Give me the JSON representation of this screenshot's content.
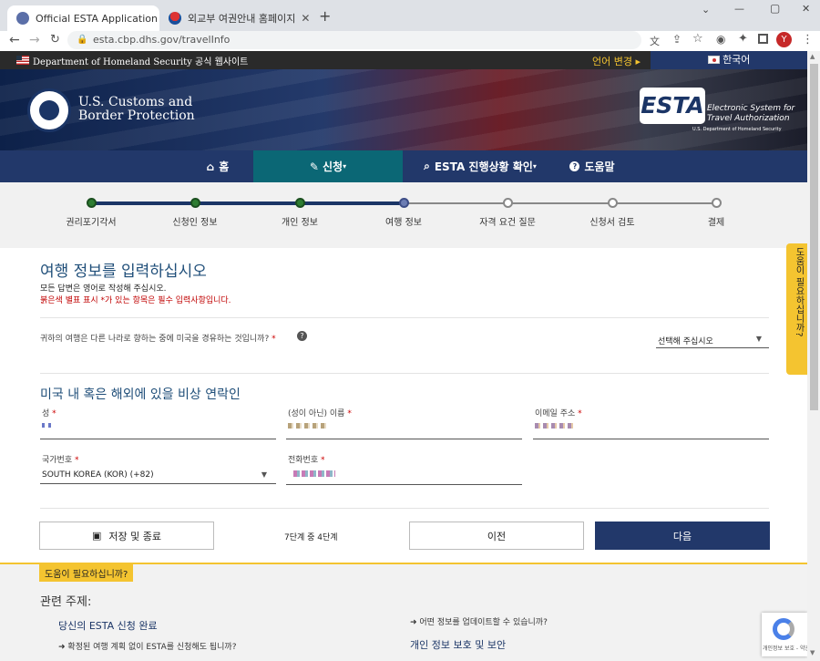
{
  "browser": {
    "tabs": [
      {
        "title": "Official ESTA Application Websi",
        "active": true
      },
      {
        "title": "외교부 여권안내 홈페이지",
        "active": false
      }
    ],
    "new_tab": "+",
    "url": "esta.cbp.dhs.gov/travelInfo",
    "avatar": "Y",
    "window_controls": [
      "⌄",
      "—",
      "▢",
      "✕"
    ]
  },
  "site": {
    "top_strip": {
      "agency": "Department of Homeland Security 공식 웹사이트",
      "change_language": "언어 변경",
      "language": "한국어"
    },
    "banner": {
      "org_line1": "U.S. Customs and",
      "org_line2": "Border Protection",
      "esta_logo": "ESTA",
      "esta_line1": "Electronic System for",
      "esta_line2": "Travel Authorization",
      "esta_line3": "U.S. Department of Homeland Security"
    },
    "nav": {
      "home": "홈",
      "apply": "신청",
      "status": "ESTA 진행상황 확인",
      "help": "도움말"
    },
    "steps": [
      {
        "label": "권리포기각서",
        "state": "done"
      },
      {
        "label": "신청인 정보",
        "state": "done"
      },
      {
        "label": "개인 정보",
        "state": "done"
      },
      {
        "label": "여행 정보",
        "state": "current"
      },
      {
        "label": "자격 요건 질문",
        "state": "todo"
      },
      {
        "label": "신청서 검토",
        "state": "todo"
      },
      {
        "label": "결제",
        "state": "todo"
      }
    ],
    "side_help": "도움이 필요하십니까?",
    "form": {
      "title": "여행 정보를 입력하십시오",
      "note": "모든 답변은 영어로 작성해 주십시오.",
      "required_note": "붉은색 별표 표시 *가 있는 항목은 필수 입력사항입니다.",
      "transit_question": "귀하의 여행은 다른 나라로 향하는 중에 미국을 경유하는 것입니까?",
      "transit_select": "선택해 주십시오",
      "section_title": "미국 내 혹은 해외에 있을 비상 연락인",
      "last_name_label": "성",
      "first_name_label": "(성이 아닌) 이름",
      "email_label": "이메일 주소",
      "country_code_label": "국가번호",
      "country_code_value": "SOUTH KOREA (KOR) (+82)",
      "phone_label": "전화번호",
      "save_button": "저장 및 종료",
      "step_count": "7단계 중 4단계",
      "prev_button": "이전",
      "next_button": "다음"
    },
    "footer": {
      "help_badge": "도움이 필요하십니까?",
      "related_title": "관련 주제:",
      "link1": "당신의 ESTA 신청 완료",
      "link2": "확정된 여행 계획 없이 ESTA를 신청해도 됩니까?",
      "link3": "어떤 정보를 업데이트할 수 있습니까?",
      "link4": "개인 정보 보호 및 보안",
      "recaptcha": "개인정보 보호 - 약관"
    }
  },
  "colors": {
    "nav": "#22386a",
    "accent": "#f4c430",
    "title": "#1f4e79",
    "required": "#c00000",
    "next_button": "#22386a"
  }
}
